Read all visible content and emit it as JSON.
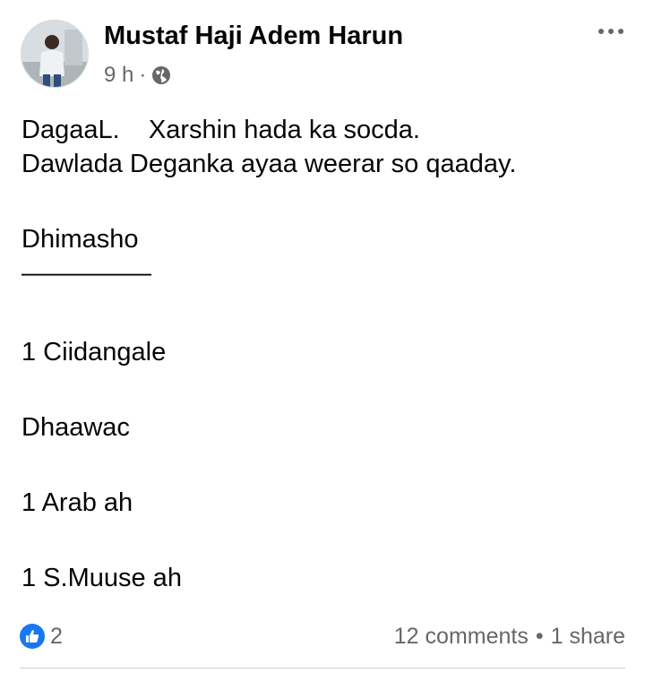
{
  "post": {
    "author": "Mustaf Haji Adem Harun",
    "time": "9 h",
    "separator": "·",
    "privacy_icon": "globe-icon",
    "more_icon": "more-horizontal-icon",
    "lines": [
      "DagaaL.    Xarshin hada ka socda.",
      "Dawlada Deganka ayaa weerar so qaaday.",
      "Dhimasho",
      "—————",
      "1 Ciidangale",
      "Dhaawac",
      "1 Arab ah",
      "1 S.Muuse ah"
    ]
  },
  "footer": {
    "reaction_icon": "like-icon",
    "reaction_count": "2",
    "comments": "12 comments",
    "bullet": "•",
    "shares": "1 share"
  },
  "colors": {
    "accent": "#1877f2",
    "secondary_text": "#65676b",
    "primary_text": "#050505"
  }
}
